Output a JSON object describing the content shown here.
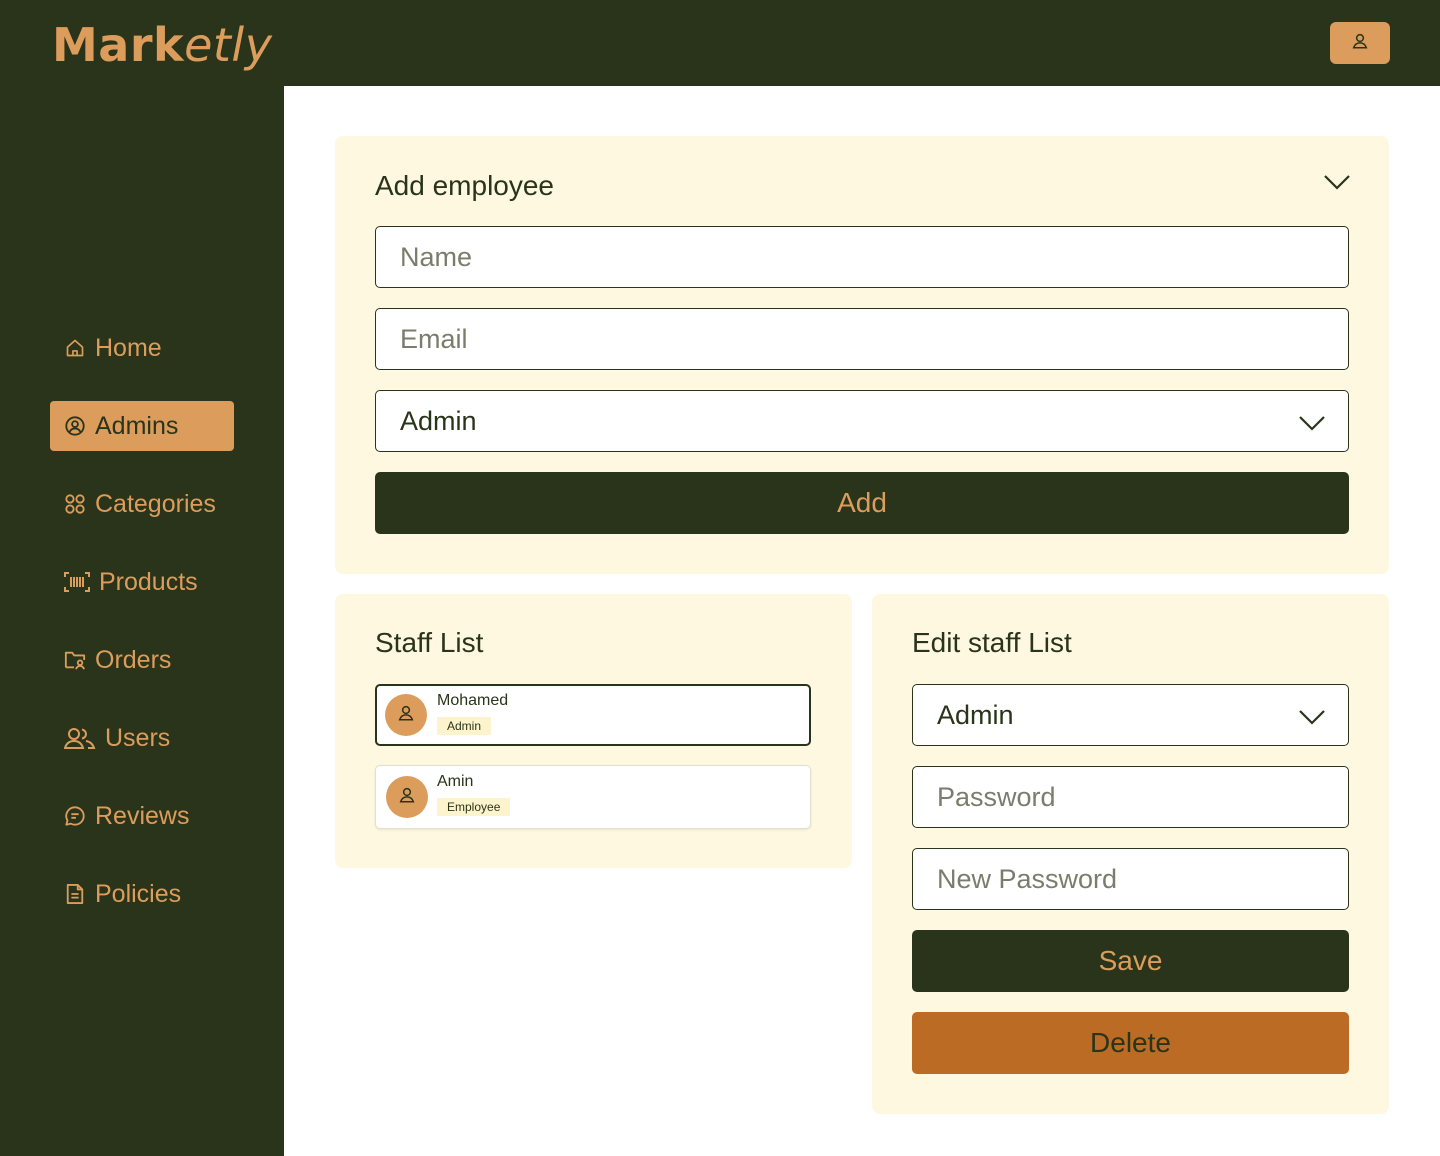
{
  "app": {
    "logo_bold": "Mark",
    "logo_italic": "etly"
  },
  "colors": {
    "dark_green": "#29341a",
    "accent": "#dc9d5c",
    "card_bg": "#fdf8df",
    "delete": "#bc6b24"
  },
  "header": {
    "profile_icon": "user-icon"
  },
  "sidebar": {
    "items": [
      {
        "label": "Home",
        "icon": "home-icon"
      },
      {
        "label": "Admins",
        "icon": "user-circle-icon",
        "active": true
      },
      {
        "label": "Categories",
        "icon": "grid-icon"
      },
      {
        "label": "Products",
        "icon": "barcode-icon"
      },
      {
        "label": "Orders",
        "icon": "folder-user-icon"
      },
      {
        "label": "Users",
        "icon": "users-icon"
      },
      {
        "label": "Reviews",
        "icon": "chat-icon"
      },
      {
        "label": "Policies",
        "icon": "document-icon"
      }
    ]
  },
  "add_employee": {
    "title": "Add employee",
    "name_placeholder": "Name",
    "email_placeholder": "Email",
    "role_value": "Admin",
    "add_label": "Add"
  },
  "staff_list": {
    "title": "Staff List",
    "members": [
      {
        "name": "Mohamed",
        "role": "Admin"
      },
      {
        "name": "Amin",
        "role": "Employee"
      }
    ]
  },
  "edit_staff": {
    "title": "Edit staff List",
    "role_value": "Admin",
    "password_placeholder": "Password",
    "new_password_placeholder": "New Password",
    "save_label": "Save",
    "delete_label": "Delete"
  }
}
